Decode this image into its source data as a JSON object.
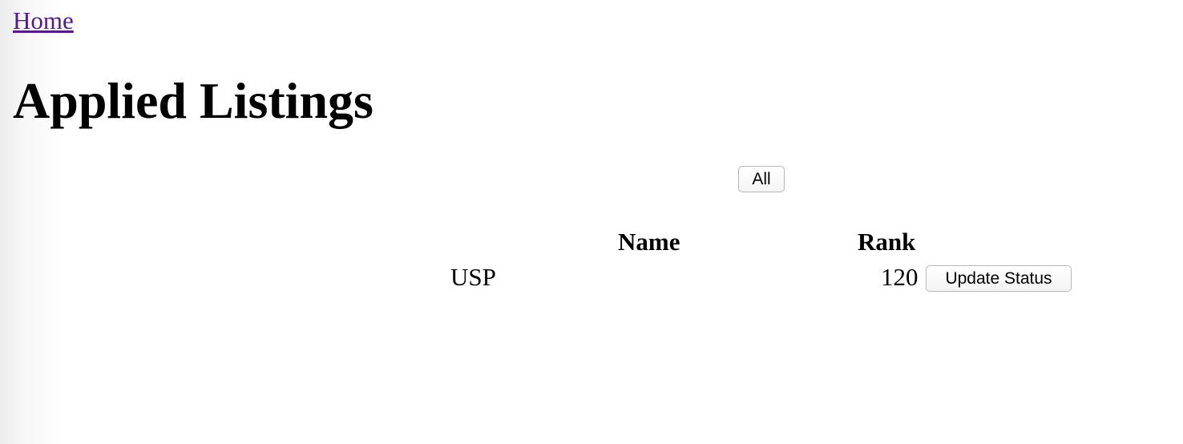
{
  "nav": {
    "home_label": "Home"
  },
  "page": {
    "title": "Applied Listings"
  },
  "filters": {
    "all_label": "All"
  },
  "table": {
    "headers": {
      "name": "Name",
      "rank": "Rank"
    },
    "rows": [
      {
        "name": "USP",
        "rank": "120",
        "action_label": "Update Status"
      }
    ]
  },
  "colors": {
    "visited_link": "#551a8b"
  }
}
